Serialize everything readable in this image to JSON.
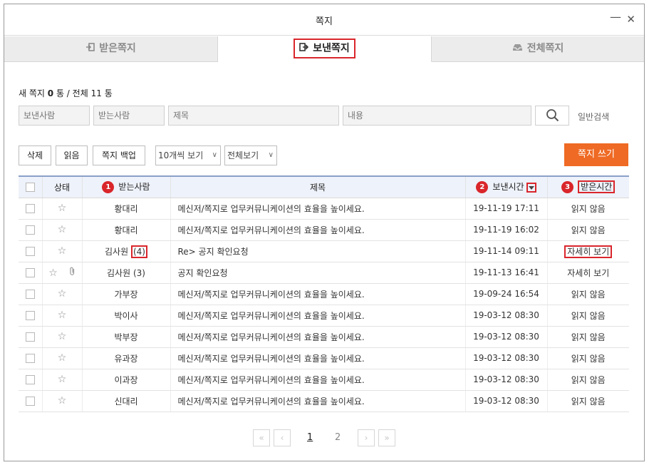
{
  "window": {
    "title": "쪽지",
    "minimize_glyph": "—",
    "close_glyph": "✕"
  },
  "tabs": [
    {
      "label": "받은쪽지",
      "icon": "inbox-in-icon",
      "active": false
    },
    {
      "label": "보낸쪽지",
      "icon": "send-out-icon",
      "active": true
    },
    {
      "label": "전체쪽지",
      "icon": "tray-icon",
      "active": false
    }
  ],
  "counter": {
    "prefix": "새 쪽지",
    "new_count": "0",
    "mid": "통 / 전체",
    "total_count": "11",
    "suffix": "통"
  },
  "search": {
    "sender_placeholder": "보낸사람",
    "recipient_placeholder": "받는사람",
    "subject_placeholder": "제목",
    "content_placeholder": "내용",
    "button_icon": "search-icon",
    "mode_link": "일반검색"
  },
  "toolbar": {
    "delete_label": "삭제",
    "read_label": "읽음",
    "backup_label": "쪽지 백업",
    "per_page_value": "10개씩 보기",
    "filter_value": "전체보기",
    "write_label": "쪽지 쓰기"
  },
  "table": {
    "headers": {
      "status": "상태",
      "recipient": "받는사람",
      "subject": "제목",
      "sent_time": "보낸시간",
      "received_time": "받은시간"
    },
    "markers": [
      "1",
      "2",
      "3"
    ],
    "rows": [
      {
        "recipient": "황대리",
        "count": "",
        "subject": "메신저/쪽지로 업무커뮤니케이션의 효율을 높이세요.",
        "sent": "19-11-19 17:11",
        "received": "읽지 않음"
      },
      {
        "recipient": "황대리",
        "count": "",
        "subject": "메신저/쪽지로 업무커뮤니케이션의 효율을 높이세요.",
        "sent": "19-11-19 16:02",
        "received": "읽지 않음"
      },
      {
        "recipient": "김사원",
        "count": "(4)",
        "subject": "Re> 공지 확인요청",
        "sent": "19-11-14 09:11",
        "received": "자세히 보기"
      },
      {
        "recipient": "김사원",
        "count": "(3)",
        "subject": "공지 확인요청",
        "sent": "19-11-13 16:41",
        "received": "자세히 보기"
      },
      {
        "recipient": "가부장",
        "count": "",
        "subject": "메신저/쪽지로 업무커뮤니케이션의 효율을 높이세요.",
        "sent": "19-09-24 16:54",
        "received": "읽지 않음"
      },
      {
        "recipient": "박이사",
        "count": "",
        "subject": "메신저/쪽지로 업무커뮤니케이션의 효율을 높이세요.",
        "sent": "19-03-12 08:30",
        "received": "읽지 않음"
      },
      {
        "recipient": "박부장",
        "count": "",
        "subject": "메신저/쪽지로 업무커뮤니케이션의 효율을 높이세요.",
        "sent": "19-03-12 08:30",
        "received": "읽지 않음"
      },
      {
        "recipient": "유과장",
        "count": "",
        "subject": "메신저/쪽지로 업무커뮤니케이션의 효율을 높이세요.",
        "sent": "19-03-12 08:30",
        "received": "읽지 않음"
      },
      {
        "recipient": "이과장",
        "count": "",
        "subject": "메신저/쪽지로 업무커뮤니케이션의 효율을 높이세요.",
        "sent": "19-03-12 08:30",
        "received": "읽지 않음"
      },
      {
        "recipient": "신대리",
        "count": "",
        "subject": "메신저/쪽지로 업무커뮤니케이션의 효율을 높이세요.",
        "sent": "19-03-12 08:30",
        "received": "읽지 않음"
      }
    ]
  },
  "pagination": {
    "first_glyph": "«",
    "prev_glyph": "‹",
    "pages": [
      "1",
      "2"
    ],
    "current": "1",
    "next_glyph": "›",
    "last_glyph": "»"
  },
  "colors": {
    "accent_orange": "#ef6a24",
    "highlight_red": "#d9262b",
    "header_bg": "#eef2fa"
  }
}
